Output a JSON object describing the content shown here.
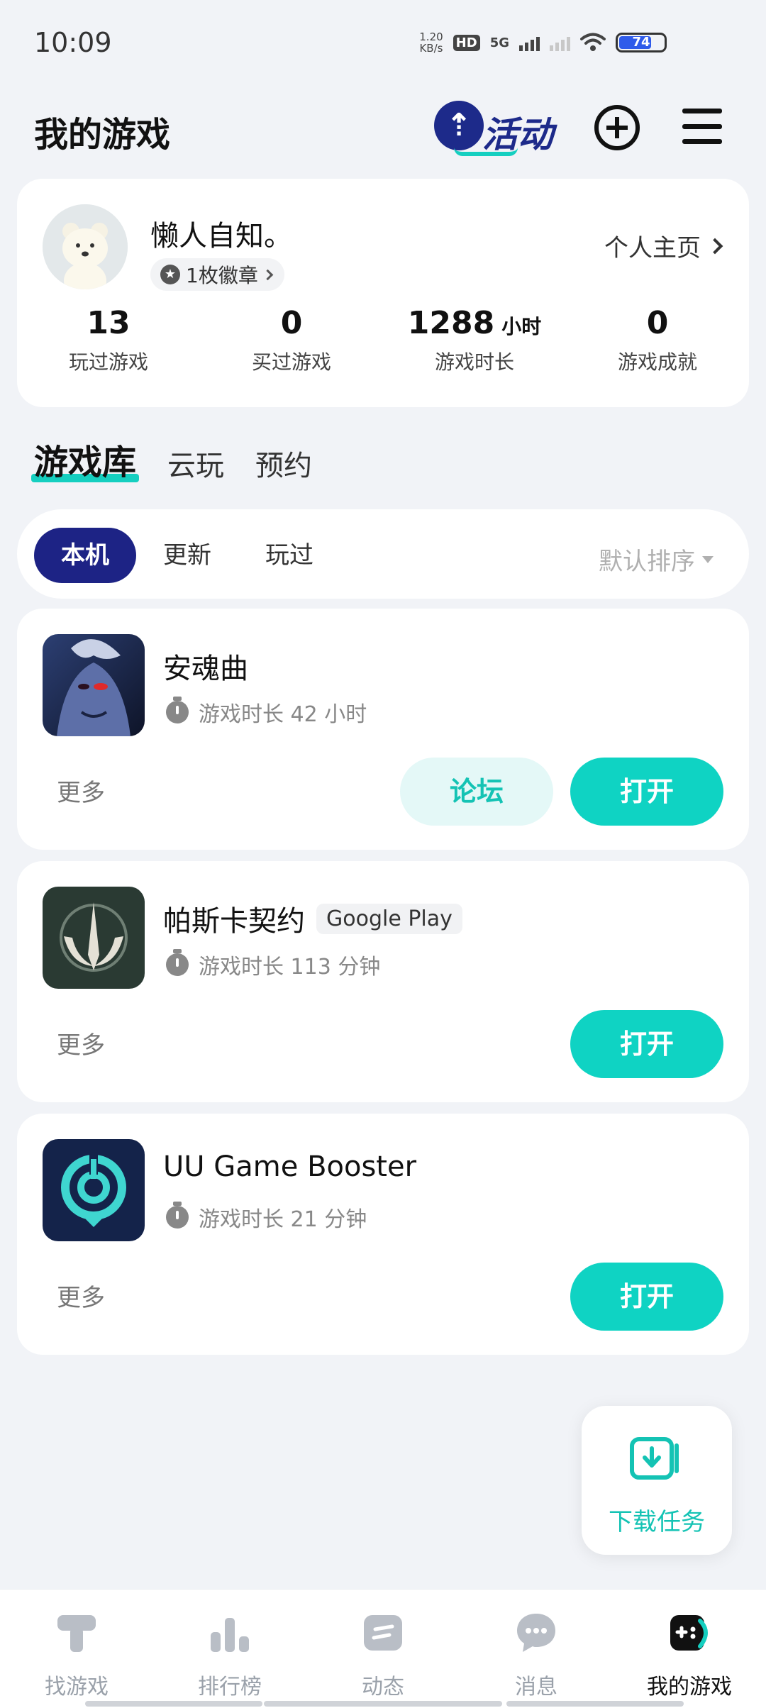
{
  "status_bar": {
    "time": "10:09",
    "net_speed_value": "1.20",
    "net_speed_unit": "KB/s",
    "hd_label": "HD",
    "network_type": "5G",
    "battery_level": "74"
  },
  "header": {
    "title": "我的游戏",
    "activity_label": "活动"
  },
  "profile": {
    "name": "懒人自知。",
    "badge_label": "1枚徽章",
    "homepage_label": "个人主页",
    "stats": [
      {
        "value": "13",
        "unit": "",
        "label": "玩过游戏"
      },
      {
        "value": "0",
        "unit": "",
        "label": "买过游戏"
      },
      {
        "value": "1288",
        "unit": "小时",
        "label": "游戏时长"
      },
      {
        "value": "0",
        "unit": "",
        "label": "游戏成就"
      }
    ]
  },
  "library_tabs": [
    "游戏库",
    "云玩",
    "预约"
  ],
  "filters": {
    "items": [
      "本机",
      "更新",
      "玩过"
    ],
    "sort_label": "默认排序"
  },
  "games": [
    {
      "name": "安魂曲",
      "store_tag": "",
      "playtime": "游戏时长 42 小时",
      "more_label": "更多",
      "forum_label": "论坛",
      "open_label": "打开"
    },
    {
      "name": "帕斯卡契约",
      "store_tag": "Google Play",
      "playtime": "游戏时长 113 分钟",
      "more_label": "更多",
      "forum_label": "",
      "open_label": "打开"
    },
    {
      "name": "UU Game Booster",
      "store_tag": "",
      "playtime": "游戏时长 21 分钟",
      "more_label": "更多",
      "forum_label": "",
      "open_label": "打开"
    }
  ],
  "download_fab": {
    "label": "下载任务"
  },
  "bottom_nav": [
    {
      "label": "找游戏",
      "icon": "find-games-icon"
    },
    {
      "label": "排行榜",
      "icon": "ranking-icon"
    },
    {
      "label": "动态",
      "icon": "feed-icon"
    },
    {
      "label": "消息",
      "icon": "message-icon"
    },
    {
      "label": "我的游戏",
      "icon": "my-games-icon"
    }
  ],
  "colors": {
    "accent": "#0fd3c3",
    "primary_dark": "#1d2385",
    "background": "#f1f3f7"
  }
}
